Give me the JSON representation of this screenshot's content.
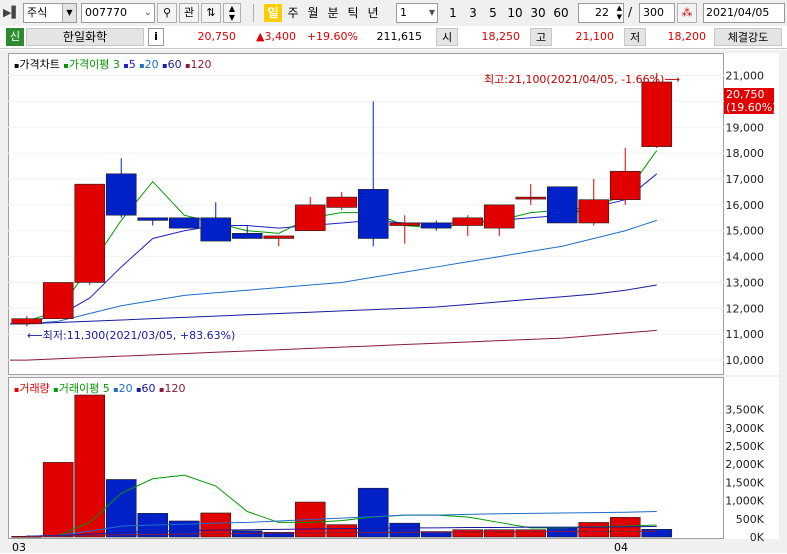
{
  "toolbar": {
    "market": "주식",
    "code": "007770",
    "search_label": "관",
    "periods": [
      "일",
      "주",
      "월",
      "분",
      "틱",
      "년"
    ],
    "interval_value": "1",
    "quick_intervals": [
      "1",
      "3",
      "5",
      "10",
      "30",
      "60"
    ],
    "count_value": "22",
    "total_value": "300",
    "slash": "/",
    "date_value": "2021/04/05"
  },
  "info": {
    "badge": "신",
    "name": "한일화학",
    "info_button": "i",
    "price": "20,750",
    "change": "▲3,400",
    "change_pct": "+19.60%",
    "volume": "211,615",
    "open_label": "시",
    "open": "18,250",
    "high_label": "고",
    "high": "21,100",
    "low_label": "저",
    "low": "18,200",
    "strength_label": "체결강도"
  },
  "colors": {
    "up": "#e00000",
    "down": "#0020c8",
    "ma3": "#009900",
    "ma5": "#2020c0",
    "ma20": "#1e6ec8",
    "ma60": "#1a1aa0",
    "ma120": "#8b1a3a"
  },
  "price_legend": {
    "title": "가격차트",
    "ma_label": "가격이평",
    "ma3": "3",
    "ma5": "5",
    "ma20": "20",
    "ma60": "60",
    "ma120": "120"
  },
  "volume_legend": {
    "title": "거래량",
    "ma_label": "거래이평",
    "ma5": "5",
    "ma20": "20",
    "ma60": "60",
    "ma120": "120"
  },
  "annotations": {
    "high_text": "최고:21,100(2021/04/05, -1.66%)",
    "low_text": "최저:11,300(2021/03/05, +83.63%)",
    "last_price": "20,750",
    "last_pct": "(19.60%)"
  },
  "chart_data": [
    {
      "type": "candlestick",
      "title": "가격차트",
      "ylim": [
        9500,
        21600
      ],
      "yticks": [
        "21,000",
        "20,000",
        "19,000",
        "18,000",
        "17,000",
        "16,000",
        "15,000",
        "14,000",
        "13,000",
        "12,000",
        "11,000",
        "10,000"
      ],
      "x_labels": [
        "03",
        "04"
      ],
      "series": [
        {
          "name": "candles",
          "candles": [
            [
              11400,
              11700,
              11300,
              11600
            ],
            [
              11600,
              13000,
              11600,
              13000
            ],
            [
              13000,
              16800,
              12900,
              16800
            ],
            [
              17200,
              17800,
              15500,
              15600
            ],
            [
              15500,
              15500,
              15200,
              15400
            ],
            [
              15500,
              15500,
              15100,
              15100
            ],
            [
              15500,
              16100,
              14700,
              14600
            ],
            [
              14900,
              15200,
              14800,
              14700
            ],
            [
              14700,
              14800,
              14400,
              14800
            ],
            [
              15000,
              16300,
              15000,
              16000
            ],
            [
              15900,
              16500,
              15800,
              16300
            ],
            [
              16600,
              20000,
              14400,
              14700
            ],
            [
              15200,
              15600,
              14500,
              15300
            ],
            [
              15300,
              15400,
              15000,
              15100
            ],
            [
              15200,
              15600,
              14800,
              15500
            ],
            [
              15100,
              16000,
              14800,
              16000
            ],
            [
              16300,
              16800,
              16000,
              16300
            ],
            [
              16700,
              16700,
              15300,
              15300
            ],
            [
              15300,
              17000,
              15200,
              16200
            ],
            [
              16200,
              18200,
              16000,
              17300
            ],
            [
              18250,
              21100,
              18200,
              20750
            ]
          ]
        },
        {
          "name": "3",
          "values": [
            11500,
            11900,
            13600,
            15400,
            16900,
            15600,
            15300,
            15000,
            14900,
            15500,
            15700,
            15700,
            15200,
            15100,
            15300,
            15400,
            15700,
            15800,
            15900,
            16400,
            18100
          ]
        },
        {
          "name": "5",
          "values": [
            11500,
            11700,
            12400,
            13600,
            14700,
            15000,
            15200,
            15200,
            15100,
            15200,
            15300,
            15400,
            15300,
            15300,
            15300,
            15400,
            15500,
            15600,
            15900,
            16200,
            17200
          ]
        },
        {
          "name": "20",
          "values": [
            11400,
            11500,
            11800,
            12100,
            12300,
            12500,
            12600,
            12700,
            12800,
            12900,
            13000,
            13200,
            13400,
            13600,
            13800,
            14000,
            14200,
            14400,
            14700,
            15000,
            15400
          ]
        },
        {
          "name": "60",
          "values": [
            11400,
            11450,
            11500,
            11550,
            11600,
            11650,
            11700,
            11750,
            11800,
            11850,
            11900,
            11950,
            12000,
            12050,
            12150,
            12250,
            12350,
            12450,
            12550,
            12700,
            12900
          ]
        },
        {
          "name": "120",
          "values": [
            10000,
            10050,
            10100,
            10150,
            10200,
            10250,
            10300,
            10350,
            10400,
            10450,
            10500,
            10550,
            10600,
            10650,
            10700,
            10750,
            10800,
            10850,
            10950,
            11050,
            11150
          ]
        }
      ]
    },
    {
      "type": "bar",
      "title": "거래량",
      "ylim": [
        0,
        3900000
      ],
      "yticks": [
        "3,500K",
        "3,000K",
        "2,500K",
        "2,000K",
        "1,500K",
        "1,000K",
        "500K",
        "0K"
      ],
      "values": [
        20000,
        2050000,
        3900000,
        1580000,
        650000,
        440000,
        660000,
        170000,
        130000,
        960000,
        340000,
        1340000,
        380000,
        150000,
        200000,
        200000,
        200000,
        250000,
        400000,
        540000,
        211615
      ],
      "colors": [
        "up",
        "up",
        "up",
        "down",
        "down",
        "down",
        "up",
        "down",
        "down",
        "up",
        "up",
        "down",
        "down",
        "down",
        "up",
        "up",
        "up",
        "down",
        "up",
        "up",
        "down"
      ],
      "series": [
        {
          "name": "5",
          "values": [
            20000,
            40000,
            400000,
            1200000,
            1600000,
            1700000,
            1400000,
            700000,
            400000,
            400000,
            450000,
            550000,
            600000,
            600000,
            550000,
            400000,
            250000,
            250000,
            280000,
            300000,
            330000
          ]
        },
        {
          "name": "20",
          "values": [
            20000,
            40000,
            160000,
            300000,
            330000,
            350000,
            380000,
            400000,
            440000,
            480000,
            520000,
            560000,
            600000,
            600000,
            620000,
            640000,
            650000,
            660000,
            670000,
            680000,
            700000
          ]
        },
        {
          "name": "60",
          "values": [
            20000,
            40000,
            80000,
            120000,
            150000,
            170000,
            190000,
            200000,
            210000,
            220000,
            230000,
            240000,
            250000,
            250000,
            260000,
            260000,
            270000,
            270000,
            270000,
            280000,
            290000
          ]
        },
        {
          "name": "120",
          "values": [
            10000,
            20000,
            40000,
            60000,
            70000,
            80000,
            90000,
            100000,
            110000,
            110000,
            120000,
            120000,
            130000,
            130000,
            140000,
            140000,
            140000,
            150000,
            150000,
            150000,
            160000
          ]
        }
      ]
    }
  ]
}
